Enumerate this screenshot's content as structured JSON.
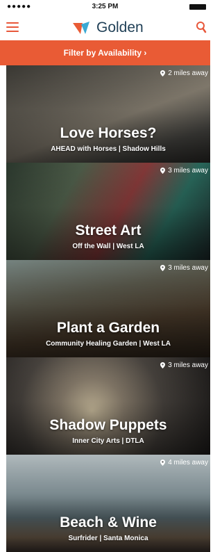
{
  "status_bar": {
    "signal": "●●●●● ",
    "time": "3:25 PM"
  },
  "header": {
    "title": "Golden",
    "menu_icon": "hamburger-icon",
    "search_icon": "search-icon",
    "accent": "#e95b35"
  },
  "filter": {
    "label": "Filter by Availability ›"
  },
  "cards": [
    {
      "title": "Love Horses?",
      "subtitle": "AHEAD with Horses | Shadow Hills",
      "distance": "2 miles away"
    },
    {
      "title": "Street Art",
      "subtitle": "Off the Wall | West LA",
      "distance": "3 miles away"
    },
    {
      "title": "Plant a Garden",
      "subtitle": "Community Healing Garden | West LA",
      "distance": "3 miles away"
    },
    {
      "title": "Shadow Puppets",
      "subtitle": "Inner City Arts | DTLA",
      "distance": "3 miles away"
    },
    {
      "title": "Beach & Wine",
      "subtitle": "Surfrider | Santa Monica",
      "distance": "4 miles away"
    }
  ]
}
